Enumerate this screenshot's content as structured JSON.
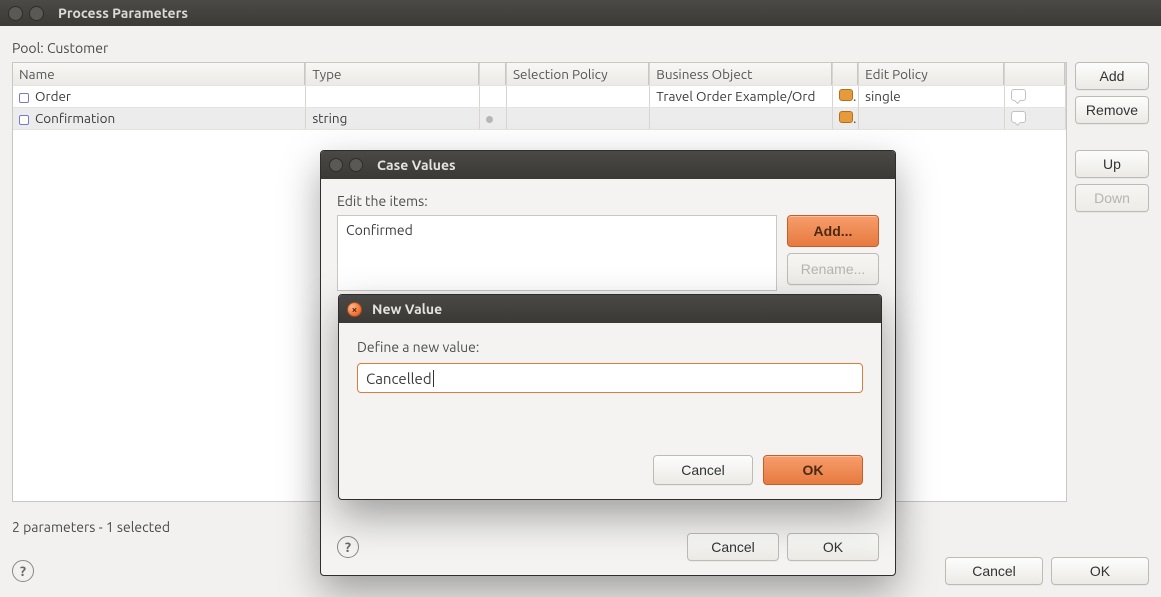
{
  "main": {
    "title": "Process Parameters",
    "pool_label": "Pool: Customer",
    "table": {
      "headers": {
        "name": "Name",
        "type": "Type",
        "selection_policy": "Selection Policy",
        "business_object": "Business Object",
        "edit_policy": "Edit Policy"
      },
      "rows": [
        {
          "name": "Order",
          "type": "",
          "sel_policy": "",
          "business_object": "Travel Order Example/Ord",
          "edit_policy": "single",
          "selected": false
        },
        {
          "name": "Confirmation",
          "type": "string",
          "sel_policy": "",
          "business_object": "",
          "edit_policy": "",
          "selected": true
        }
      ]
    },
    "side": {
      "add": "Add",
      "remove": "Remove",
      "up": "Up",
      "down": "Down"
    },
    "status": "2 parameters - 1 selected",
    "footer": {
      "cancel": "Cancel",
      "ok": "OK"
    }
  },
  "case_values": {
    "title": "Case Values",
    "label": "Edit the items:",
    "items": [
      "Confirmed"
    ],
    "buttons": {
      "add": "Add...",
      "rename": "Rename..."
    },
    "footer": {
      "cancel": "Cancel",
      "ok": "OK"
    }
  },
  "new_value": {
    "title": "New Value",
    "label": "Define a new value:",
    "input_value": "Cancelled",
    "footer": {
      "cancel": "Cancel",
      "ok": "OK"
    }
  },
  "icons": {
    "help": "?",
    "close_x": "×"
  }
}
